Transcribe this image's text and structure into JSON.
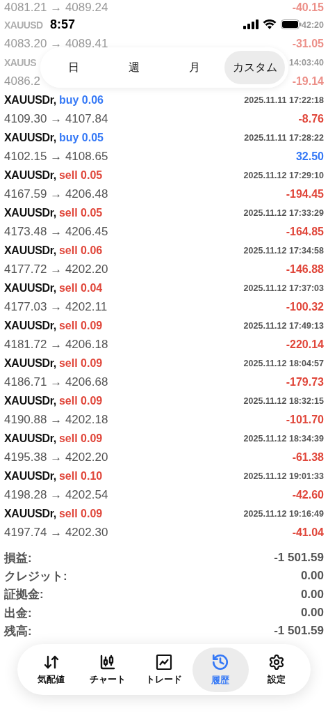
{
  "status_bar": {
    "time": "8:57"
  },
  "behind_header": [
    {
      "prices": "4081.21 → 4089.24",
      "profit": "-40.15"
    },
    {
      "symbol": "XAUUSD",
      "time": "42:20",
      "prices": "4083.20 → 4089.41",
      "profit": "-31.05"
    },
    {
      "symbol": "XAUUS",
      "time": "14:03:40",
      "prices": "4086.2",
      "profit": "-19.14"
    }
  ],
  "period_tabs": [
    {
      "label": "日",
      "selected": false
    },
    {
      "label": "週",
      "selected": false
    },
    {
      "label": "月",
      "selected": false
    },
    {
      "label": "カスタム",
      "selected": true
    }
  ],
  "trades": [
    {
      "symbol": "XAUUSDr,",
      "order": "buy 0.06",
      "color": "#3478f6",
      "time": "2025.11.11 17:22:18",
      "prices": "4109.30 → 4107.84",
      "profit": "-8.76",
      "gain": false
    },
    {
      "symbol": "XAUUSDr,",
      "order": "buy 0.05",
      "color": "#3478f6",
      "time": "2025.11.11 17:28:22",
      "prices": "4102.15 → 4108.65",
      "profit": "32.50",
      "gain": true
    },
    {
      "symbol": "XAUUSDr,",
      "order": "sell 0.05",
      "color": "#e0463a",
      "time": "2025.11.12 17:29:10",
      "prices": "4167.59 → 4206.48",
      "profit": "-194.45",
      "gain": false
    },
    {
      "symbol": "XAUUSDr,",
      "order": "sell 0.05",
      "color": "#e0463a",
      "time": "2025.11.12 17:33:29",
      "prices": "4173.48 → 4206.45",
      "profit": "-164.85",
      "gain": false
    },
    {
      "symbol": "XAUUSDr,",
      "order": "sell 0.06",
      "color": "#e0463a",
      "time": "2025.11.12 17:34:58",
      "prices": "4177.72 → 4202.20",
      "profit": "-146.88",
      "gain": false
    },
    {
      "symbol": "XAUUSDr,",
      "order": "sell 0.04",
      "color": "#e0463a",
      "time": "2025.11.12 17:37:03",
      "prices": "4177.03 → 4202.11",
      "profit": "-100.32",
      "gain": false
    },
    {
      "symbol": "XAUUSDr,",
      "order": "sell 0.09",
      "color": "#e0463a",
      "time": "2025.11.12 17:49:13",
      "prices": "4181.72 → 4206.18",
      "profit": "-220.14",
      "gain": false
    },
    {
      "symbol": "XAUUSDr,",
      "order": "sell 0.09",
      "color": "#e0463a",
      "time": "2025.11.12 18:04:57",
      "prices": "4186.71 → 4206.68",
      "profit": "-179.73",
      "gain": false
    },
    {
      "symbol": "XAUUSDr,",
      "order": "sell 0.09",
      "color": "#e0463a",
      "time": "2025.11.12 18:32:15",
      "prices": "4190.88 → 4202.18",
      "profit": "-101.70",
      "gain": false
    },
    {
      "symbol": "XAUUSDr,",
      "order": "sell 0.09",
      "color": "#e0463a",
      "time": "2025.11.12 18:34:39",
      "prices": "4195.38 → 4202.20",
      "profit": "-61.38",
      "gain": false
    },
    {
      "symbol": "XAUUSDr,",
      "order": "sell 0.10",
      "color": "#e0463a",
      "time": "2025.11.12 19:01:33",
      "prices": "4198.28 → 4202.54",
      "profit": "-42.60",
      "gain": false
    },
    {
      "symbol": "XAUUSDr,",
      "order": "sell 0.09",
      "color": "#e0463a",
      "time": "2025.11.12 19:16:49",
      "prices": "4197.74 → 4202.30",
      "profit": "-41.04",
      "gain": false
    }
  ],
  "summary": [
    {
      "label": "損益:",
      "value": "-1 501.59"
    },
    {
      "label": "クレジット:",
      "value": "0.00"
    },
    {
      "label": "証拠金:",
      "value": "0.00"
    },
    {
      "label": "出金:",
      "value": "0.00"
    },
    {
      "label": "残高:",
      "value": "-1 501.59"
    }
  ],
  "nav": [
    {
      "label": "気配値",
      "kind": "quotes",
      "selected": false
    },
    {
      "label": "チャート",
      "kind": "chart",
      "selected": false
    },
    {
      "label": "トレード",
      "kind": "trade",
      "selected": false
    },
    {
      "label": "履歴",
      "kind": "history",
      "selected": true
    },
    {
      "label": "設定",
      "kind": "settings",
      "selected": false
    }
  ]
}
